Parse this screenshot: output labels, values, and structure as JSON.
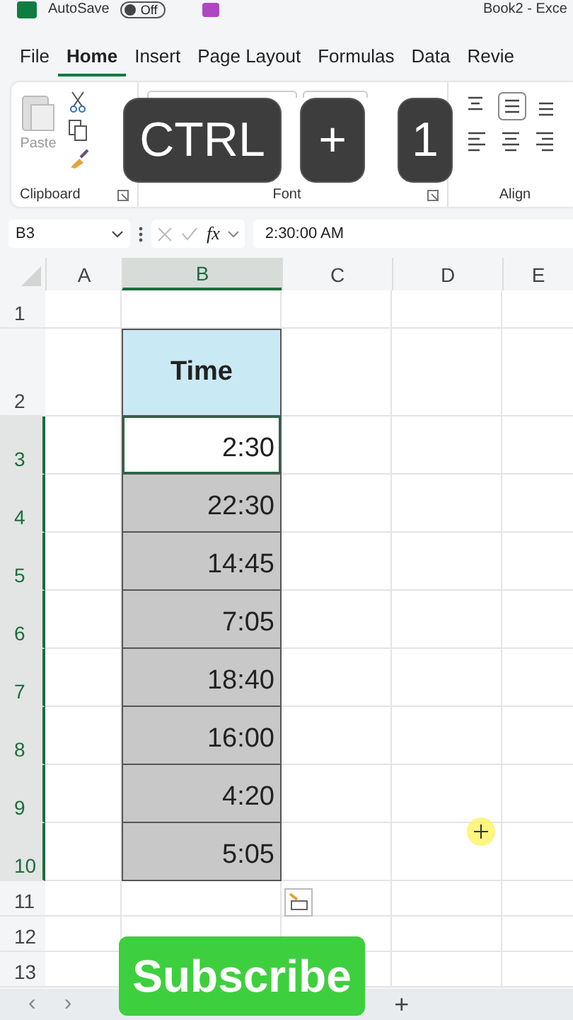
{
  "title_bar": {
    "autosave_label": "AutoSave",
    "toggle_label": "Off",
    "toggle_on": false,
    "document": "Book2 - Exce"
  },
  "ribbon_tabs": [
    {
      "label": "File",
      "selected": false
    },
    {
      "label": "Home",
      "selected": true
    },
    {
      "label": "Insert",
      "selected": false
    },
    {
      "label": "Page Layout",
      "selected": false
    },
    {
      "label": "Formulas",
      "selected": false
    },
    {
      "label": "Data",
      "selected": false
    },
    {
      "label": "Revie",
      "selected": false
    }
  ],
  "ribbon": {
    "paste_label": "Paste",
    "groups": [
      "Clipboard",
      "Font",
      "Align"
    ]
  },
  "formula_bar": {
    "name_box": "B3",
    "fx": "fx",
    "value": "2:30:00 AM"
  },
  "columns": [
    {
      "label": "A",
      "selected": false
    },
    {
      "label": "B",
      "selected": true
    },
    {
      "label": "C",
      "selected": false
    },
    {
      "label": "D",
      "selected": false
    },
    {
      "label": "E",
      "selected": false
    }
  ],
  "rows": [
    {
      "num": "1",
      "kind": "blank",
      "selected": false
    },
    {
      "num": "2",
      "kind": "header",
      "value": "Time",
      "selected": false
    },
    {
      "num": "3",
      "kind": "value",
      "value": "2:30",
      "selected": true,
      "active": true
    },
    {
      "num": "4",
      "kind": "value",
      "value": "22:30",
      "selected": true,
      "active": false
    },
    {
      "num": "5",
      "kind": "value",
      "value": "14:45",
      "selected": true,
      "active": false
    },
    {
      "num": "6",
      "kind": "value",
      "value": "7:05",
      "selected": true,
      "active": false
    },
    {
      "num": "7",
      "kind": "value",
      "value": "18:40",
      "selected": true,
      "active": false
    },
    {
      "num": "8",
      "kind": "value",
      "value": "16:00",
      "selected": true,
      "active": false
    },
    {
      "num": "9",
      "kind": "value",
      "value": "4:20",
      "selected": true,
      "active": false
    },
    {
      "num": "10",
      "kind": "value",
      "value": "5:05",
      "selected": true,
      "active": false
    },
    {
      "num": "11",
      "kind": "blank",
      "selected": false
    },
    {
      "num": "12",
      "kind": "blank",
      "selected": false
    },
    {
      "num": "13",
      "kind": "blank",
      "selected": false
    }
  ],
  "sheet_bar": {
    "prev": "‹",
    "next": "›",
    "add": "+"
  },
  "keys": [
    "CTRL",
    "+",
    "1"
  ],
  "subscribe": "Subscribe"
}
